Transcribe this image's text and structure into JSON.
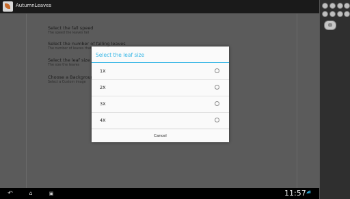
{
  "app": {
    "title": "AutumnLeaves"
  },
  "preferences": [
    {
      "title": "Select the fall speed",
      "summary": "The speed the leaves fall"
    },
    {
      "title": "Select the number of falling leaves",
      "summary": "The number of leaves that f..."
    },
    {
      "title": "Select the leaf size",
      "summary": "The size the leaves"
    },
    {
      "title": "Choose a Background",
      "summary": "Select a Custom image"
    }
  ],
  "dialog": {
    "title": "Select the leaf size",
    "options": [
      "1X",
      "2X",
      "3X",
      "4X"
    ],
    "cancel_label": "Cancel"
  },
  "navbar": {
    "clock": "11:57",
    "back_icon": "back-arrow-icon",
    "home_icon": "home-icon",
    "recents_icon": "recent-apps-icon"
  },
  "colors": {
    "accent": "#33b5e5",
    "dim_background": "#5b5b5b",
    "dialog_background": "#fafafa"
  }
}
